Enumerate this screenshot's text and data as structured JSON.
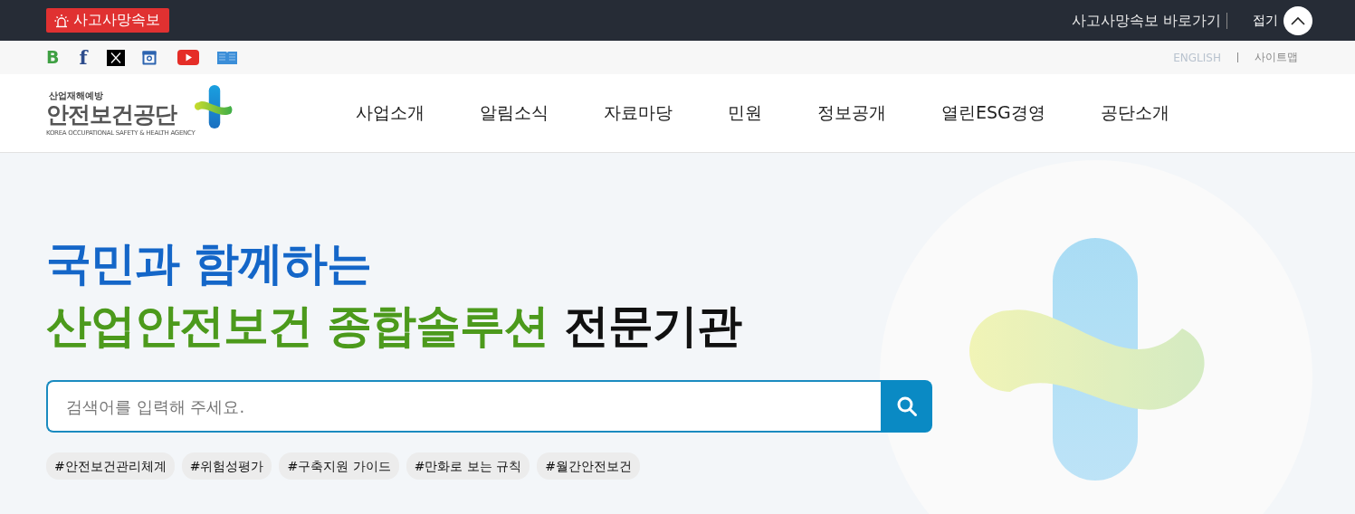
{
  "alert_bar": {
    "badge": "사고사망속보",
    "link": "사고사망속보 바로가기",
    "collapse_label": "접기"
  },
  "utility_bar": {
    "social": [
      {
        "kind": "blog",
        "glyph": "B"
      },
      {
        "kind": "facebook",
        "glyph": "f"
      },
      {
        "kind": "x"
      },
      {
        "kind": "instagram"
      },
      {
        "kind": "youtube"
      },
      {
        "kind": "book"
      }
    ],
    "links": [
      {
        "kind": "english",
        "label": "ENGLISH"
      },
      {
        "kind": "sitemap",
        "label": "사이트맵"
      }
    ]
  },
  "header": {
    "logo": {
      "subtitle": "산업재해예방",
      "name": "안전보건공단",
      "english": "KOREA OCCUPATIONAL SAFETY & HEALTH AGENCY"
    },
    "nav": [
      "사업소개",
      "알림소식",
      "자료마당",
      "민원",
      "정보공개",
      "열린ESG경영",
      "공단소개"
    ]
  },
  "hero": {
    "headline_line1": "국민과 함께하는",
    "headline_highlight": "산업안전보건 종합솔루션",
    "headline_rest": "전문기관",
    "search": {
      "placeholder": "검색어를 입력해 주세요."
    },
    "tags": [
      "#안전보건관리체계",
      "#위험성평가",
      "#구축지원 가이드",
      "#만화로 보는 규칙",
      "#월간안전보건"
    ]
  }
}
